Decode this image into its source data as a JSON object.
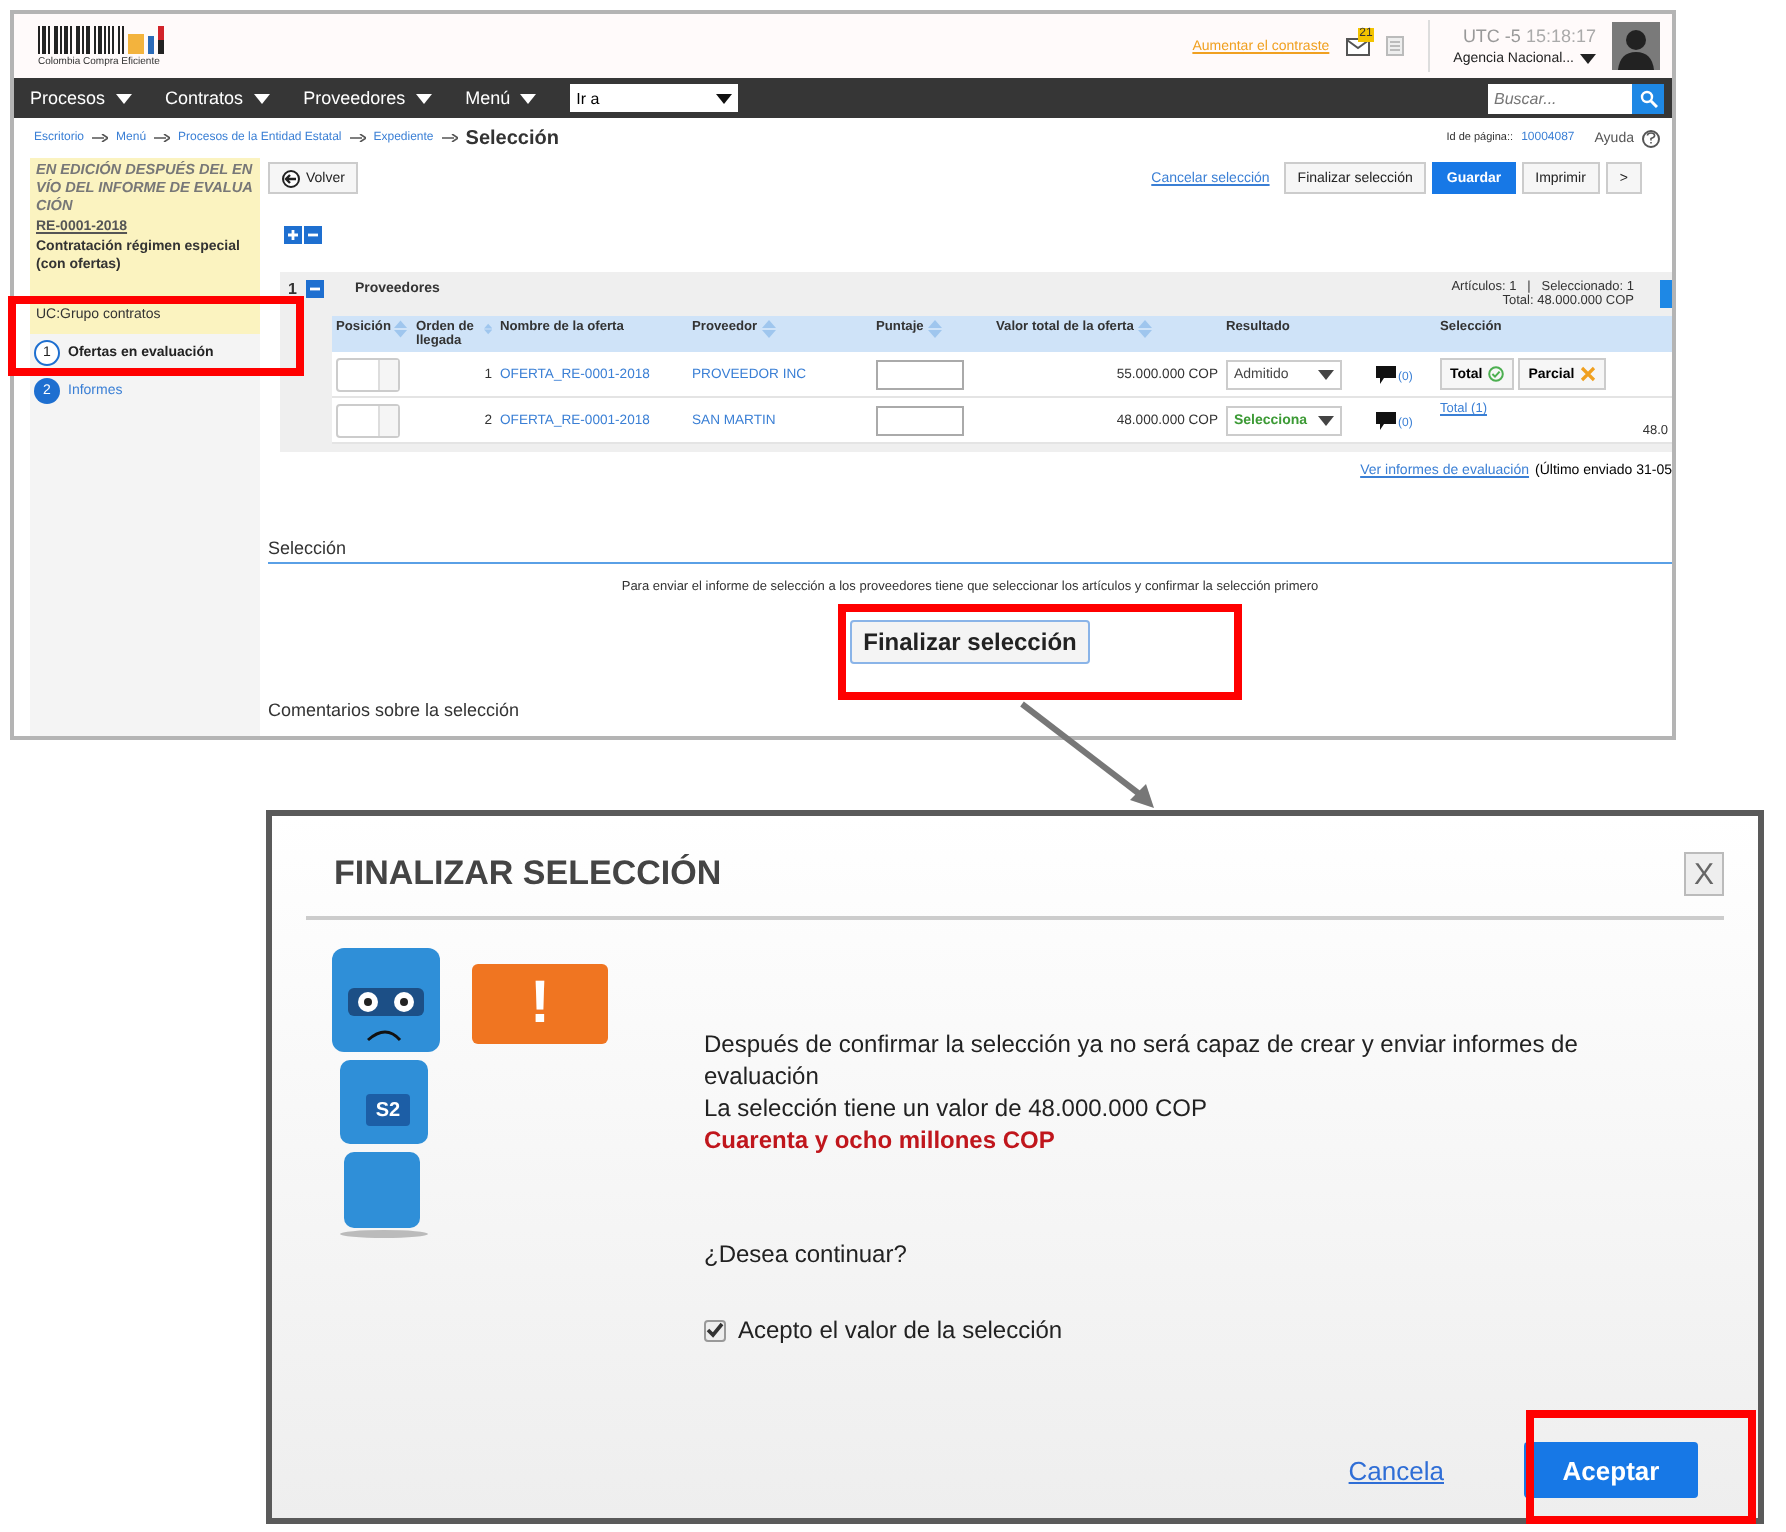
{
  "header": {
    "logo_text": "Colombia Compra Eficiente",
    "contrast_link": "Aumentar el contraste",
    "mail_badge": "21",
    "clock_zone": "UTC -5",
    "clock_time": "15:18:17",
    "account": "Agencia Nacional..."
  },
  "navbar": {
    "menus": [
      "Procesos",
      "Contratos",
      "Proveedores",
      "Menú"
    ],
    "goto": "Ir a",
    "search": {
      "placeholder": "Buscar..."
    }
  },
  "breadcrumb": [
    "Escritorio",
    "Menú",
    "Procesos de la Entidad Estatal",
    "Expediente"
  ],
  "page_title": "Selección",
  "page_id": {
    "label": "Id de página::",
    "value": "10004087"
  },
  "help": "Ayuda",
  "sidebar": {
    "status": "EN EDICIÓN DESPUÉS DEL ENVÍO DEL INFORME DE EVALUACIÓN",
    "process_id": "RE-0001-2018",
    "process_type": "Contratación régimen especial (con ofertas)",
    "unit": "UC:Grupo contratos",
    "steps": [
      {
        "number": "1",
        "label": "Ofertas en evaluación",
        "selected": true
      },
      {
        "number": "2",
        "label": "Informes",
        "selected": false
      }
    ]
  },
  "toolbar": {
    "back": "Volver",
    "cancel": "Cancelar selección",
    "buttons": [
      {
        "label": "Finalizar selección",
        "kind": "default"
      },
      {
        "label": "Guardar",
        "kind": "primary"
      },
      {
        "label": "Imprimir",
        "kind": "default"
      },
      {
        "label": ">",
        "kind": "default"
      }
    ]
  },
  "section": {
    "number": "1",
    "title": "Proveedores",
    "summary": "Artículos: 1   |   Seleccionado: 1",
    "total": "Total: 48.000.000 COP"
  },
  "table": {
    "columns": [
      {
        "label": "Posición",
        "sortable": true
      },
      {
        "label": "Orden de llegada",
        "sortable": true
      },
      {
        "label": "Nombre de la oferta",
        "sortable": false
      },
      {
        "label": "Proveedor",
        "sortable": true
      },
      {
        "label": "Puntaje",
        "sortable": true
      },
      {
        "label": "Valor total de la oferta",
        "sortable": true
      },
      {
        "label": "Resultado",
        "sortable": false
      },
      {
        "label": "Selección",
        "sortable": false
      }
    ],
    "rows": [
      {
        "order": "1",
        "offer": "OFERTA_RE-0001-2018",
        "supplier": "PROVEEDOR INC",
        "value": "55.000.000 COP",
        "result": "Admitido",
        "result_highlighted": false,
        "comments": "(0)",
        "selection": {
          "kind": "buttons",
          "total": "Total",
          "partial": "Parcial"
        }
      },
      {
        "order": "2",
        "offer": "OFERTA_RE-0001-2018",
        "supplier": "SAN MARTIN",
        "value": "48.000.000 COP",
        "result": "Selecciona",
        "result_highlighted": true,
        "comments": "(0)",
        "selection": {
          "kind": "link",
          "link": "Total (1)",
          "extra": "48.0"
        }
      }
    ]
  },
  "reports_link": "Ver informes de evaluación",
  "last_sent": "(Último enviado 31-05",
  "selection": {
    "heading": "Selección",
    "message": "Para enviar el informe de selección a los proveedores tiene que seleccionar los artículos y confirmar la selección primero",
    "button": "Finalizar selección",
    "comments_heading": "Comentarios sobre la selección"
  },
  "dialog": {
    "title": "FINALIZAR SELECCIÓN",
    "close": "X",
    "mascot_badge": "S2",
    "alert": "!",
    "message": "Después de confirmar la selección ya no será capaz de crear y enviar informes de evaluación",
    "value_line": "La selección tiene un valor de 48.000.000 COP",
    "value_words": "Cuarenta y ocho millones COP",
    "question": "¿Desea continuar?",
    "accept_checkbox": {
      "label": "Acepto el valor de la selección",
      "checked": true
    },
    "cancel": "Cancela",
    "accept": "Aceptar"
  }
}
